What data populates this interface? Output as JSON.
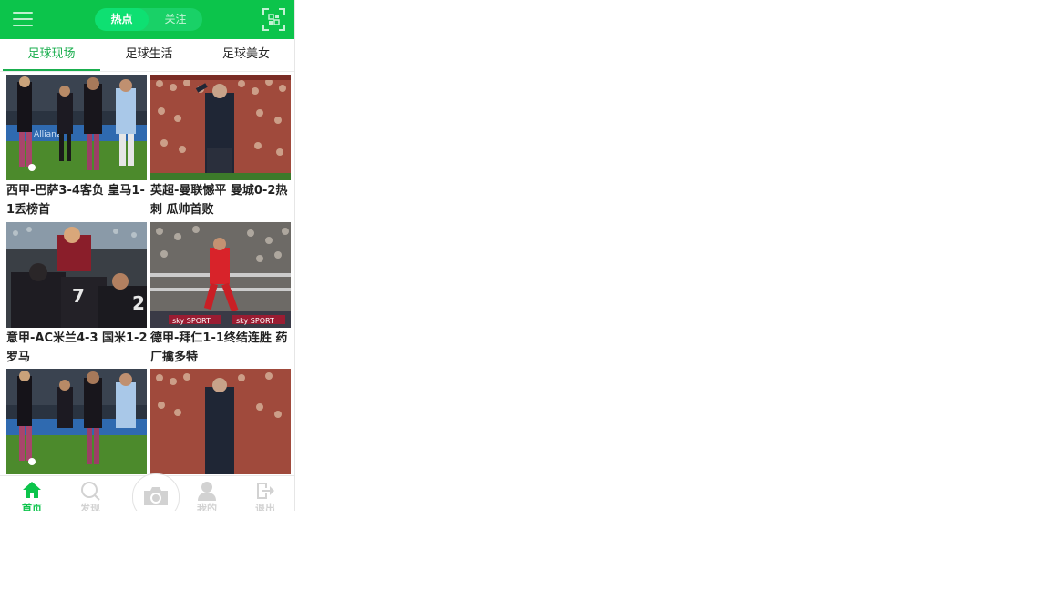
{
  "header": {
    "tabs": [
      "热点",
      "关注"
    ]
  },
  "categories": [
    "足球现场",
    "足球生活",
    "足球美女"
  ],
  "articles": [
    {
      "title": "西甲-巴萨3-4客负 皇马1-1丢榜首"
    },
    {
      "title": "英超-曼联憾平 曼城0-2热刺 瓜帅首败"
    },
    {
      "title": "意甲-AC米兰4-3 国米1-2罗马"
    },
    {
      "title": "德甲-拜仁1-1终结连胜 药厂擒多特"
    },
    {
      "title": ""
    },
    {
      "title": ""
    }
  ],
  "image_overlays": {
    "sky_sport": "sky SPORT",
    "adidas": "Allianz"
  },
  "footer": {
    "items": [
      "首页",
      "发现",
      "我的",
      "退出"
    ]
  },
  "colors": {
    "brand_green": "#0cc44b",
    "active_tab": "#1aae4e",
    "inactive_icon": "#d2d2d2"
  }
}
